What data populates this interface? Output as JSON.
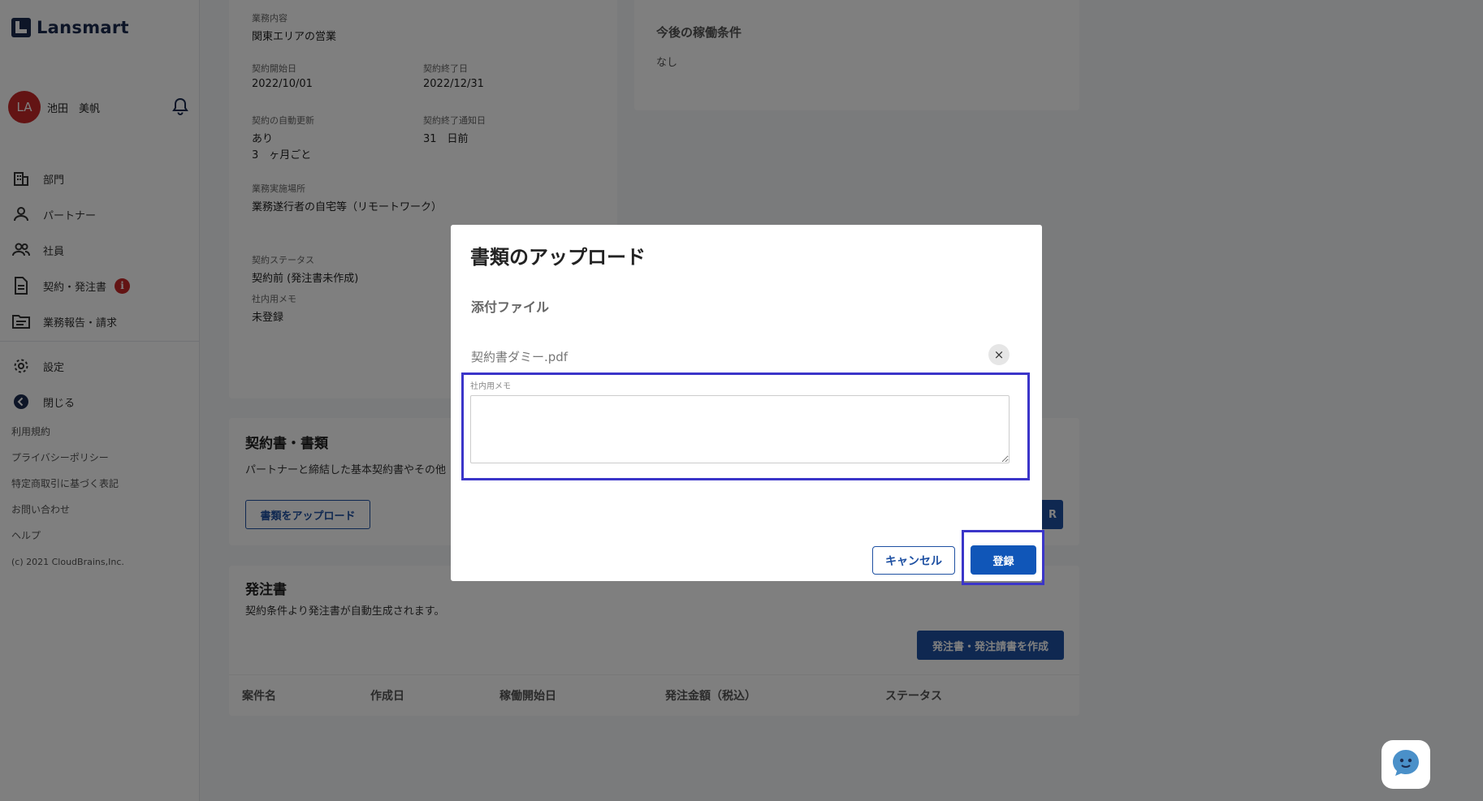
{
  "sidebar": {
    "logo_text": "Lansmart",
    "user": {
      "initials": "LA",
      "name": "池田　美帆",
      "avatar_color": "#c62828"
    },
    "nav": [
      {
        "label": "部門",
        "icon": "building-icon"
      },
      {
        "label": "パートナー",
        "icon": "person-icon"
      },
      {
        "label": "社員",
        "icon": "people-icon"
      },
      {
        "label": "契約・発注書",
        "icon": "document-icon",
        "badge": "i"
      },
      {
        "label": "業務報告・請求",
        "icon": "folder-icon"
      }
    ],
    "nav2": [
      {
        "label": "設定",
        "icon": "gear-icon"
      },
      {
        "label": "閉じる",
        "icon": "back-arrow-icon"
      }
    ],
    "footer": [
      "利用規約",
      "プライバシーポリシー",
      "特定商取引に基づく表記",
      "お問い合わせ",
      "ヘルプ"
    ],
    "copyright": "(c) 2021 CloudBrains,Inc."
  },
  "detail": {
    "work_content_label": "業務内容",
    "work_content_value": "関東エリアの営業",
    "start_date_label": "契約開始日",
    "start_date_value": "2022/10/01",
    "end_date_label": "契約終了日",
    "end_date_value": "2022/12/31",
    "auto_renew_label": "契約の自動更新",
    "auto_renew_value": "あり",
    "auto_renew_period": "3　ヶ月ごと",
    "end_notice_label": "契約終了通知日",
    "end_notice_value": "31　日前",
    "location_label": "業務実施場所",
    "location_value": "業務遂行者の自宅等（リモートワーク）",
    "status_label": "契約ステータス",
    "status_value": "契約前 (発注書未作成)",
    "memo_label": "社内用メモ",
    "memo_value": "未登録"
  },
  "future_conditions": {
    "title": "今後の稼働条件",
    "value": "なし"
  },
  "contracts": {
    "title": "契約書・書類",
    "desc": "パートナーと締結した基本契約書やその他",
    "upload_button": "書類をアップロード",
    "right_button_fragment": "R"
  },
  "orders": {
    "title": "発注書",
    "desc": "契約条件より発注書が自動生成されます。",
    "create_button": "発注書・発注請書を作成",
    "columns": [
      "案件名",
      "作成日",
      "稼働開始日",
      "発注金額（税込）",
      "ステータス"
    ]
  },
  "modal": {
    "title": "書類のアップロード",
    "section_label": "添付ファイル",
    "file_name": "契約書ダミー.pdf",
    "remove_symbol": "×",
    "memo_label": "社内用メモ",
    "memo_value": "",
    "cancel_button": "キャンセル",
    "register_button": "登録"
  },
  "colors": {
    "primary": "#1e50a2",
    "highlight": "#3b35c9",
    "badge": "#c62828"
  }
}
